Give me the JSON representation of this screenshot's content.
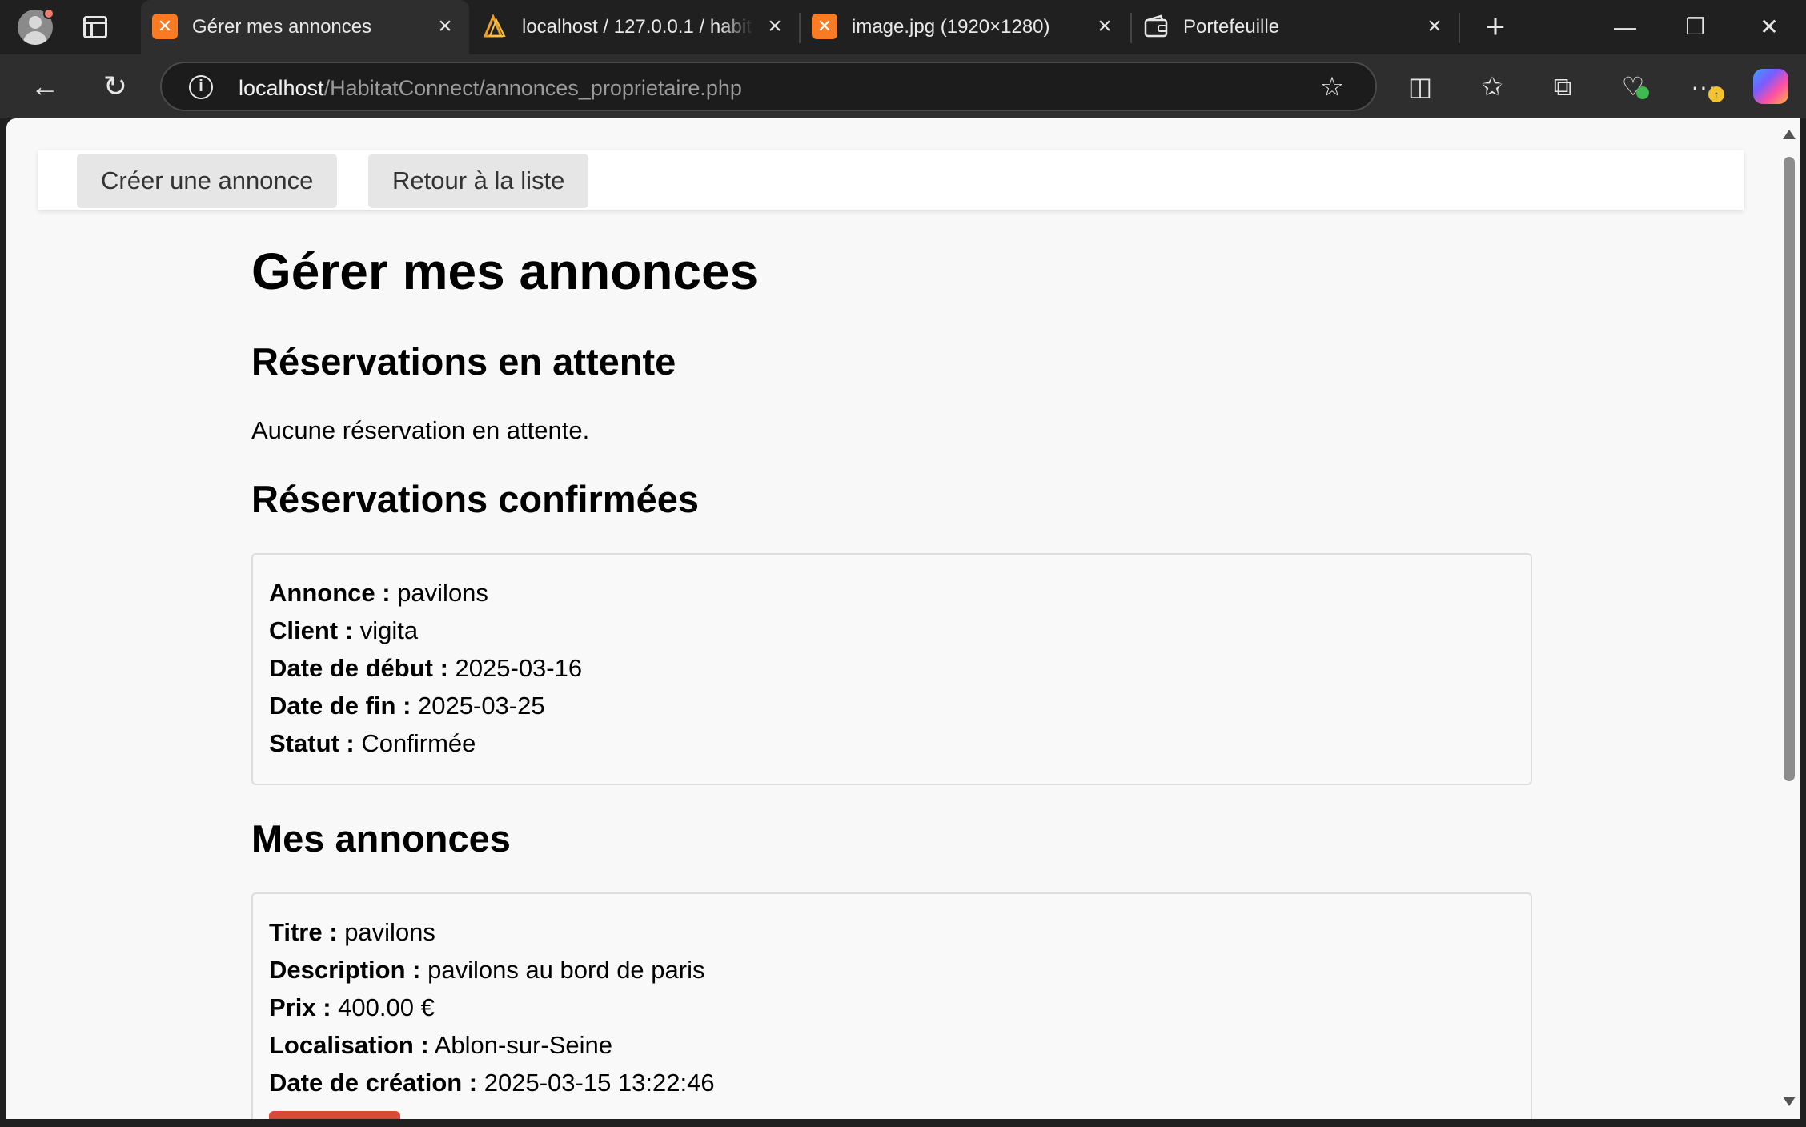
{
  "browser": {
    "tabs": [
      {
        "title": "Gérer mes annonces",
        "favicon": "xampp-icon",
        "active": true
      },
      {
        "title": "localhost / 127.0.0.1 / habit",
        "favicon": "phpmyadmin-icon",
        "active": false
      },
      {
        "title": "image.jpg (1920×1280)",
        "favicon": "xampp-icon",
        "active": false
      },
      {
        "title": "Portefeuille",
        "favicon": "wallet-icon",
        "active": false
      }
    ],
    "url_host": "localhost",
    "url_path": "/HabitatConnect/annonces_proprietaire.php",
    "accent_colors": {
      "xampp": "#fb7a24",
      "delete_button": "#d9483b"
    }
  },
  "page": {
    "nav": {
      "create_label": "Créer une annonce",
      "back_label": "Retour à la liste"
    },
    "title": "Gérer mes annonces",
    "pending": {
      "heading": "Réservations en attente",
      "empty_text": "Aucune réservation en attente."
    },
    "confirmed": {
      "heading": "Réservations confirmées",
      "reservations": [
        {
          "annonce_label": "Annonce :",
          "annonce": "pavilons",
          "client_label": "Client :",
          "client": "vigita",
          "start_label": "Date de début :",
          "start": "2025-03-16",
          "end_label": "Date de fin :",
          "end": "2025-03-25",
          "status_label": "Statut :",
          "status": "Confirmée"
        }
      ]
    },
    "listings": {
      "heading": "Mes annonces",
      "items": [
        {
          "title_label": "Titre :",
          "title": "pavilons",
          "description_label": "Description :",
          "description": "pavilons au bord de paris",
          "price_label": "Prix :",
          "price": "400.00 €",
          "location_label": "Localisation :",
          "location": "Ablon-sur-Seine",
          "created_label": "Date de création :",
          "created": "2025-03-15 13:22:46"
        }
      ]
    }
  }
}
